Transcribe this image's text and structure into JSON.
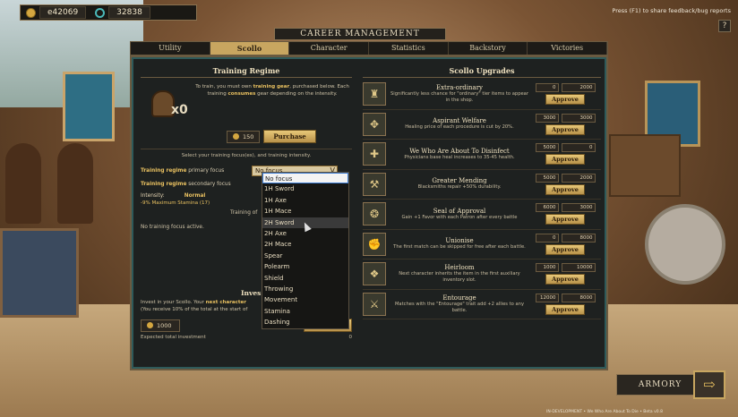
{
  "hud": {
    "gold": "e42069",
    "favor": "32838",
    "hint": "Press (F1) to share feedback/bug reports",
    "help_label": "?"
  },
  "window": {
    "title": "CAREER MANAGEMENT",
    "tabs": [
      "Utility",
      "Scollo",
      "Character",
      "Statistics",
      "Backstory",
      "Victories"
    ],
    "active_tab": "Scollo"
  },
  "training": {
    "header": "Training Regime",
    "gear_multiplier": "x0",
    "desc_parts": [
      "To train, you must own ",
      "training gear",
      ", purchased below. Each training ",
      "consumes",
      " gear depending on the intensity."
    ],
    "cost": "150",
    "purchase_label": "Purchase",
    "select_hint": "Select your training focus(es), and training intensity.",
    "primary_label_hl": "Training regime",
    "primary_label_rest": " primary focus",
    "secondary_label_hl": "Training regime",
    "secondary_label_rest": " secondary focus",
    "primary_value": "No focus",
    "intensity_label": "Intensity:",
    "intensity_value": "Normal",
    "stamina_text": "-9% Maximum Stamina (17)",
    "training_of": "Training of",
    "no_focus_text": "No training focus active."
  },
  "dropdown": {
    "options": [
      "No focus",
      "1H Sword",
      "1H Axe",
      "1H Mace",
      "2H Sword",
      "2H Axe",
      "2H Mace",
      "Spear",
      "Polearm",
      "Shield",
      "Throwing",
      "Movement",
      "Stamina",
      "Dashing"
    ],
    "selected": "No focus",
    "hovered": "2H Sword"
  },
  "invest": {
    "header": "Inves",
    "text1_a": "Invest in your Scollo. Your ",
    "text1_hl": "next character",
    "text2": "(You receive 10% of the total at the start of",
    "amount": "1000",
    "button": "Invest",
    "expected_label": "Expected total investment",
    "expected_value": "0"
  },
  "upgrades": {
    "header": "Scollo Upgrades",
    "approve_label": "Approve",
    "items": [
      {
        "name": "Extra-ordinary",
        "desc": "Significantly less chance for \"ordinary\" tier items to appear in the shop.",
        "gold": "0",
        "favor": "2000",
        "icon": "helmet-icon",
        "glyph": "♜"
      },
      {
        "name": "Aspirant Welfare",
        "desc": "Healing price of each procedure is cut by 20%.",
        "gold": "3000",
        "favor": "3000",
        "icon": "wings-icon",
        "glyph": "✥"
      },
      {
        "name": "We Who Are About To Disinfect",
        "desc": "Physicians base heal increases to 35-45 health.",
        "gold": "5000",
        "favor": "0",
        "icon": "heal-icon",
        "glyph": "✚"
      },
      {
        "name": "Greater Mending",
        "desc": "Blacksmiths repair +50% durability.",
        "gold": "5000",
        "favor": "2000",
        "icon": "hammer-icon",
        "glyph": "⚒"
      },
      {
        "name": "Seal of Approval",
        "desc": "Gain +1 Favor with each Patron after every battle",
        "gold": "6000",
        "favor": "3000",
        "icon": "seal-icon",
        "glyph": "❂"
      },
      {
        "name": "Unionise",
        "desc": "The first match can be skipped for free after each battle.",
        "gold": "0",
        "favor": "8000",
        "icon": "fist-icon",
        "glyph": "✊"
      },
      {
        "name": "Heirloom",
        "desc": "Next character inherits the item in the first auxiliary inventory slot.",
        "gold": "1000",
        "favor": "10000",
        "icon": "heirloom-icon",
        "glyph": "❖"
      },
      {
        "name": "Entourage",
        "desc": "Matches with the \"Entourage\" trait add +2 allies to any battle.",
        "gold": "12000",
        "favor": "8000",
        "icon": "entourage-icon",
        "glyph": "⚔"
      }
    ]
  },
  "armory": {
    "label": "ARMORY",
    "arrow": "⇨"
  },
  "footer": "IN-DEVELOPMENT • We Who Are About To Die • Beta v0.8"
}
